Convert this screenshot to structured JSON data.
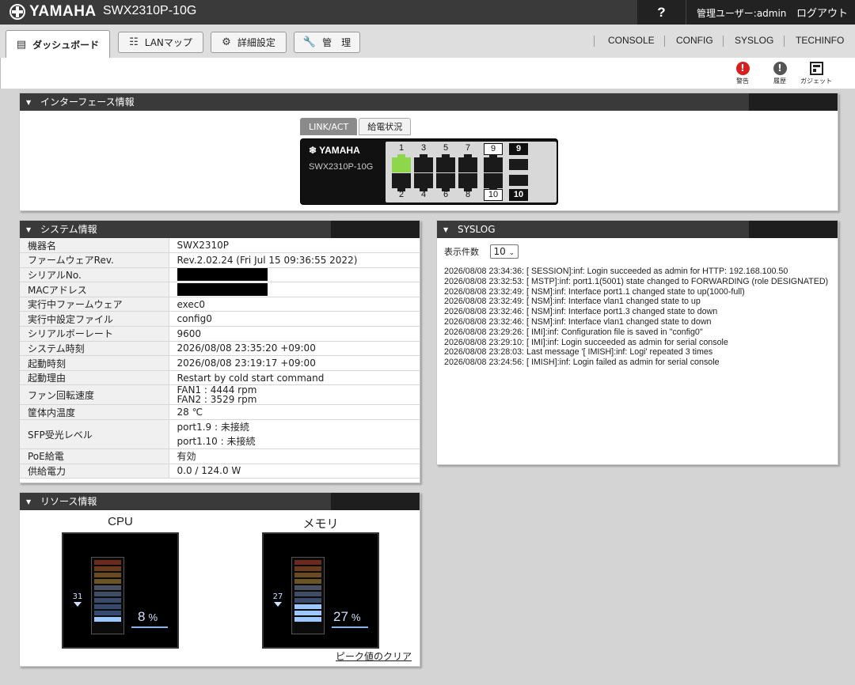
{
  "topbar": {
    "brand": "YAMAHA",
    "model": "SWX2310P-10G",
    "help": "?",
    "user_label": "管理ユーザー:",
    "user_name": "admin",
    "logout": "ログアウト"
  },
  "tabs": [
    {
      "label": "ダッシュボード",
      "icon": "dashboard-icon"
    },
    {
      "label": "LANマップ",
      "icon": "lan-map-icon"
    },
    {
      "label": "詳細設定",
      "icon": "gear-icon"
    },
    {
      "label": "管　理",
      "icon": "wrench-icon"
    }
  ],
  "toplinks": [
    "CONSOLE",
    "CONFIG",
    "SYSLOG",
    "TECHINFO"
  ],
  "iconstrip": {
    "warning": "警告",
    "history": "履歴",
    "gadget": "ガジェット",
    "colors": {
      "warning": "#d81e1e",
      "history": "#555555"
    }
  },
  "interface": {
    "title": "インターフェース情報",
    "tab_active": "LINK/ACT",
    "tab_inactive": "給電状況",
    "switch_brand": "YAMAHA",
    "switch_model": "SWX2310P-10G",
    "top_ports": [
      "1",
      "3",
      "5",
      "7"
    ],
    "bottom_ports": [
      "2",
      "4",
      "6",
      "8"
    ],
    "sfp_top": [
      "9",
      "9"
    ],
    "sfp_bottom": [
      "10",
      "10"
    ],
    "linked_ports": [
      "1"
    ],
    "link_color": "#8ed64a"
  },
  "system": {
    "title": "システム情報",
    "rows": [
      {
        "k": "機器名",
        "v": "SWX2310P"
      },
      {
        "k": "ファームウェアRev.",
        "v": "Rev.2.02.24 (Fri Jul 15 09:36:55 2022)"
      },
      {
        "k": "シリアルNo.",
        "v": ""
      },
      {
        "k": "MACアドレス",
        "v": ""
      },
      {
        "k": "実行中ファームウェア",
        "v": "exec0"
      },
      {
        "k": "実行中設定ファイル",
        "v": "config0"
      },
      {
        "k": "シリアルボーレート",
        "v": "9600"
      },
      {
        "k": "システム時刻",
        "v": "2026/08/08 23:35:20 +09:00"
      },
      {
        "k": "起動時刻",
        "v": "2026/08/08 23:19:17 +09:00"
      },
      {
        "k": "起動理由",
        "v": "Restart by cold start command"
      },
      {
        "k": "ファン回転速度",
        "v": "FAN1 : 4444 rpm",
        "v2": "FAN2 : 3529 rpm"
      },
      {
        "k": "筐体内温度",
        "v": "28 ℃"
      },
      {
        "k": "SFP受光レベル",
        "v": "port1.9 : 未接続",
        "v2": "port1.10 : 未接続"
      },
      {
        "k": "PoE給電",
        "v": "有効"
      },
      {
        "k": "供給電力",
        "v": "0.0 / 124.0 W"
      }
    ]
  },
  "syslog": {
    "title": "SYSLOG",
    "count_label": "表示件数",
    "count_value": "10",
    "entries": [
      "2026/08/08 23:34:36: [ SESSION]:inf: Login succeeded as admin for HTTP: 192.168.100.50",
      "2026/08/08 23:32:53: [ MSTP]:inf: port1.1(5001) state changed to FORWARDING (role DESIGNATED)",
      "2026/08/08 23:32:49: [ NSM]:inf: Interface port1.1 changed state to up(1000-full)",
      "2026/08/08 23:32:49: [ NSM]:inf: Interface vlan1 changed state to up",
      "2026/08/08 23:32:46: [ NSM]:inf: Interface port1.3 changed state to down",
      "2026/08/08 23:32:46: [ NSM]:inf: Interface vlan1 changed state to down",
      "2026/08/08 23:29:26: [ IMI]:inf: Configuration file is saved in \"config0\"",
      "2026/08/08 23:29:10: [ IMI]:inf: Login succeeded as admin for serial console",
      "2026/08/08 23:28:03: Last message '[ IMISH]:inf: Logi' repeated 3 times",
      "2026/08/08 23:24:56: [ IMISH]:inf: Login failed as admin for serial console"
    ]
  },
  "resource": {
    "title": "リソース情報",
    "cpu": {
      "label": "CPU",
      "value": "8",
      "unit": "%",
      "peak": "31",
      "level": 0.08
    },
    "memory": {
      "label": "メモリ",
      "value": "27",
      "unit": "%",
      "peak": "27",
      "level": 0.27
    },
    "clear_peak": "ピーク値のクリア",
    "bar_colors": [
      "#6a2a1e",
      "#6a3a1e",
      "#6a4a22",
      "#6a5426",
      "#4a5060",
      "#3e4c64",
      "#3a4a68",
      "#384a6e",
      "#364a72",
      "#34486e"
    ],
    "active_color": "#9cc8ff"
  }
}
